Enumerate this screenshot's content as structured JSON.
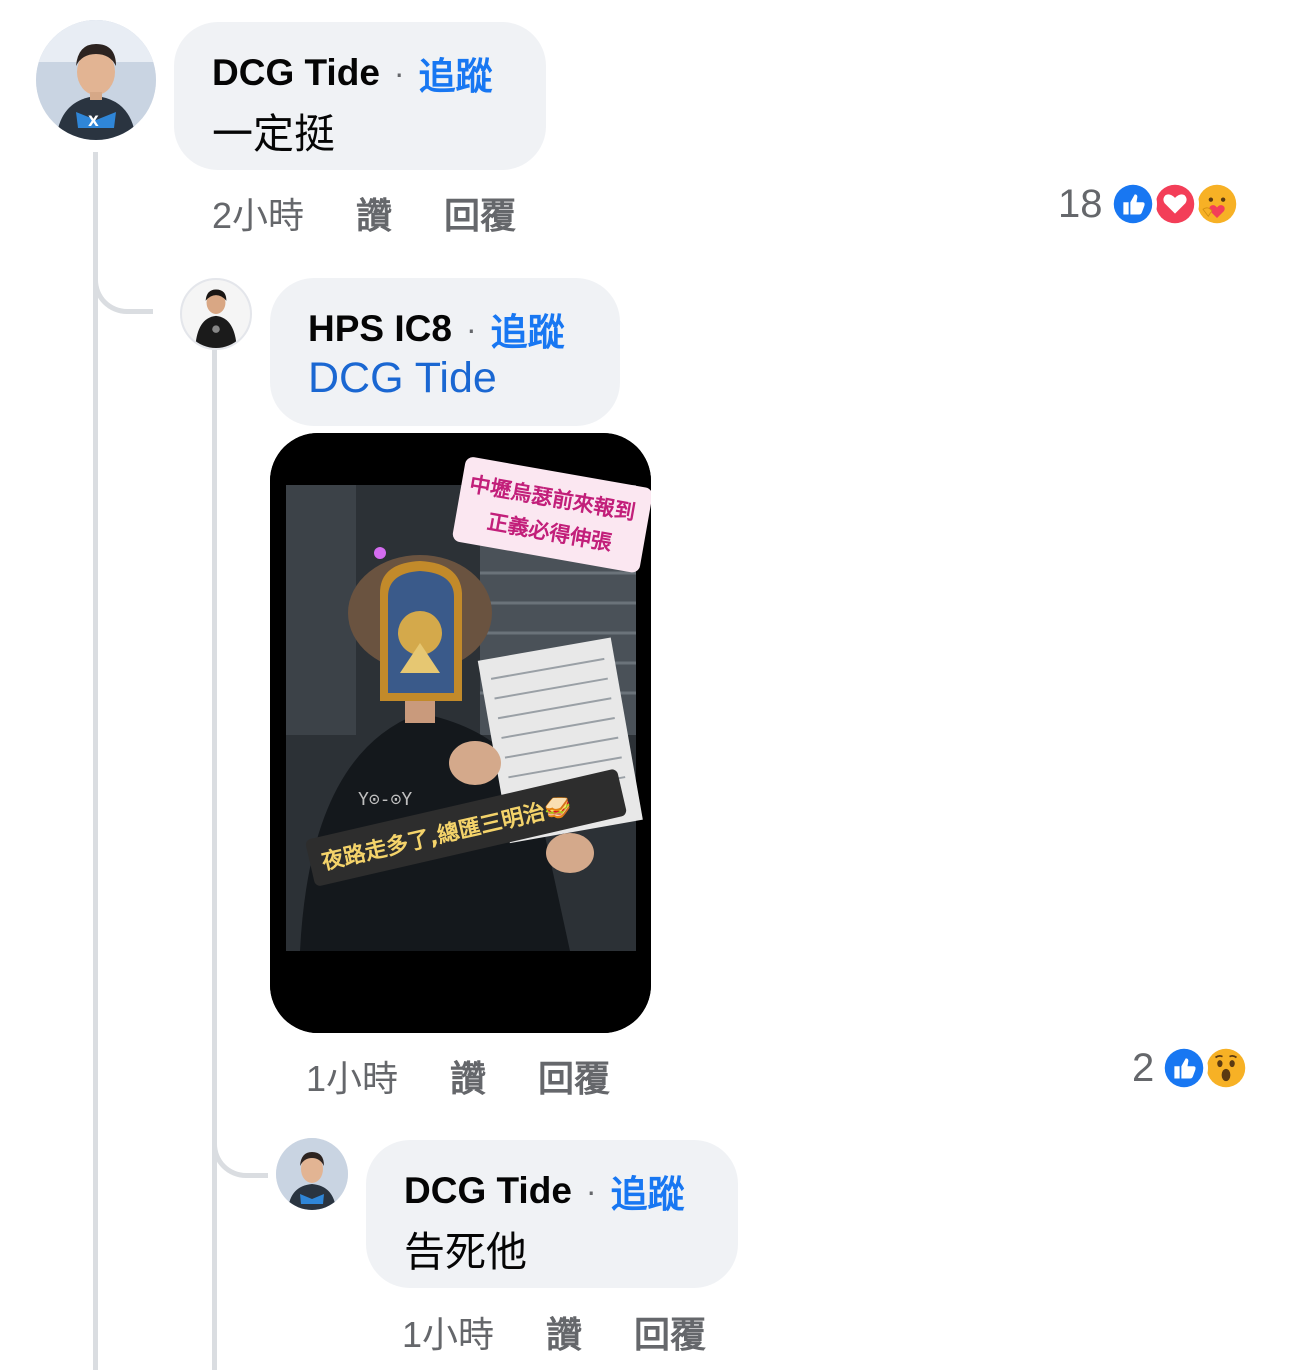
{
  "comments": [
    {
      "author": "DCG Tide",
      "follow_label": "追蹤",
      "text": "一定挺",
      "time": "2小時",
      "like_label": "讚",
      "reply_label": "回覆",
      "reaction_count": "18",
      "reactions": [
        "like-icon",
        "love-icon",
        "care-icon"
      ]
    },
    {
      "author": "HPS IC8",
      "follow_label": "追蹤",
      "mention": "DCG Tide",
      "time": "1小時",
      "like_label": "讚",
      "reply_label": "回覆",
      "reaction_count": "2",
      "reactions": [
        "like-icon",
        "wow-icon"
      ],
      "photo": {
        "sticker_top_line1": "中壢烏瑟前來報到",
        "sticker_top_line2": "正義必得伸張",
        "sticker_bottom": "夜路走多了,總匯三明治🥪",
        "shirt_text": "Y⊙-⊙Y"
      }
    },
    {
      "author": "DCG Tide",
      "follow_label": "追蹤",
      "text": "告死他",
      "time": "1小時",
      "like_label": "讚",
      "reply_label": "回覆"
    }
  ],
  "colors": {
    "link": "#1877f2",
    "meta": "#65676b",
    "bubble": "#f0f2f5",
    "like": "#1877f2",
    "love": "#f33e58"
  }
}
